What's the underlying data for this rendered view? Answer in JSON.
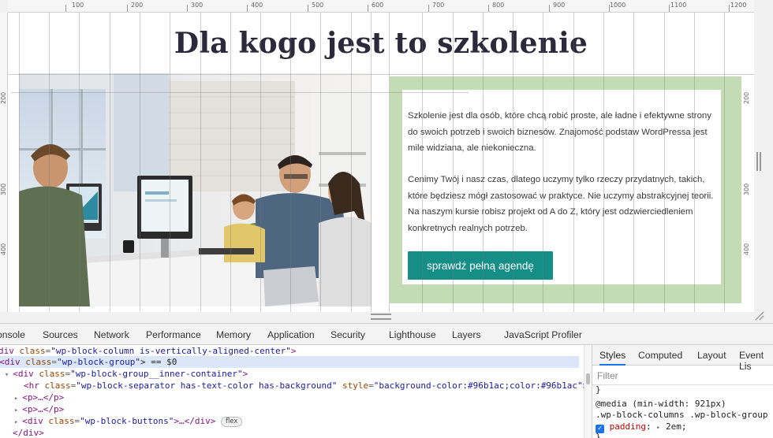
{
  "page": {
    "heading": "Dla kogo jest to szkolenie",
    "paragraph1": "Szkolenie jest dla osób, które chcą robić proste, ale ładne i efektywne strony do swoich potrzeb i swoich biznesów. Znajomość podstaw WordPressa jest mile widziana, ale niekonieczna.",
    "paragraph2": "Cenimy Twój i nasz czas, dlatego uczymy tylko rzeczy przydatnych, takich, które będziesz mógł zastosować w praktyce. Nie uczymy abstrakcyjnej teorii. Na naszym kursie robisz projekt od A do Z, który jest odzwierciedleniem konkretnych realnych potrzeb.",
    "button": "sprawdź pełną agendę",
    "photo_alt": "office-team-at-computers",
    "group_color": "#c3dcb6",
    "button_color": "#148e86"
  },
  "rulers": {
    "top": [
      "100",
      "200",
      "300",
      "400",
      "500",
      "600",
      "700",
      "800",
      "900",
      "1000",
      "1100",
      "1200"
    ],
    "left": [
      "200",
      "300",
      "400"
    ],
    "right": [
      "200",
      "300",
      "400"
    ]
  },
  "devtools": {
    "tabs": [
      "onsole",
      "Sources",
      "Network",
      "Performance",
      "Memory",
      "Application",
      "Security",
      "Lighthouse",
      "Layers",
      "JavaScript Profiler"
    ],
    "dom": {
      "l1_pre": "div ",
      "l1_attr": "class",
      "l1_val": "\"wp-block-column is-vertically-aligned-center\"",
      "l1_post": ">",
      "l2_pre": "<div ",
      "l2_attr": "class",
      "l2_val": "\"wp-block-group\"",
      "l2_post": "> == $0",
      "l3_pre": "<div ",
      "l3_attr": "class",
      "l3_val": "\"wp-block-group__inner-container\"",
      "l3_post": ">",
      "l4_pre": "<hr ",
      "l4_attr": "class",
      "l4_val": "\"wp-block-separator has-text-color has-background\"",
      "l4_attr2": " style",
      "l4_val2": "\"background-color:#96b1ac;color:#96b1ac\"",
      "l4_post": ">",
      "l5": "<p>…</p>",
      "l6": "<p>…</p>",
      "l7_pre": "<div ",
      "l7_attr": "class",
      "l7_val": "\"wp-block-buttons\"",
      "l7_post": ">…</div>",
      "l7_badge": "flex",
      "l8": "</div>"
    },
    "styles_tabs": [
      "Styles",
      "Computed",
      "Layout",
      "Event Lis"
    ],
    "filter_placeholder": "Filter",
    "css_brace": "}",
    "css_media": "@media (min-width: 921px)",
    "css_selector": ".wp-block-columns .wp-block-group {",
    "css_prop": "padding",
    "css_value": "2em;",
    "css_close": "}"
  }
}
